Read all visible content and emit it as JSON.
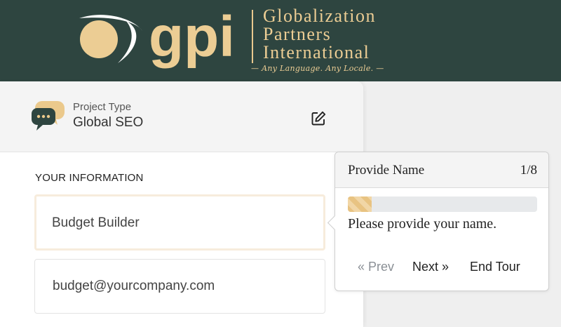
{
  "brand": {
    "logo_text": "gpi",
    "name_lines": [
      "Globalization",
      "Partners",
      "International"
    ],
    "tagline": "— Any Language. Any Locale. —",
    "colors": {
      "header_bg": "#2e4540",
      "accent": "#eccd94"
    }
  },
  "project": {
    "label": "Project Type",
    "value": "Global SEO",
    "icon": "chat-bubbles-icon",
    "edit_icon": "edit-icon"
  },
  "form": {
    "section_title": "YOUR INFORMATION",
    "name_value": "Budget Builder",
    "email_value": "budget@yourcompany.com"
  },
  "tour": {
    "title": "Provide Name",
    "step": "1/8",
    "progress": 0.125,
    "message": "Please provide your name.",
    "prev_label": "« Prev",
    "next_label": "Next »",
    "end_label": "End Tour"
  }
}
